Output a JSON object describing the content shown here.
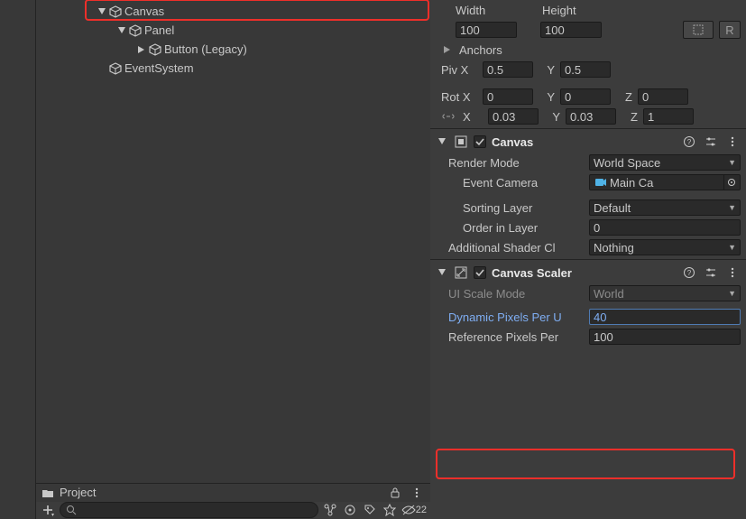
{
  "hierarchy": {
    "items": [
      {
        "label": "Canvas"
      },
      {
        "label": "Panel"
      },
      {
        "label": "Button (Legacy)"
      },
      {
        "label": "EventSystem"
      }
    ]
  },
  "project": {
    "title": "Project",
    "hidden_count": "22"
  },
  "rect": {
    "width_label": "Width",
    "height_label": "Height",
    "width": "100",
    "height": "100",
    "anchors_label": "Anchors",
    "pivot_x_label": "Piv X",
    "pivot_x": "0.5",
    "pivot_y_label": "Y",
    "pivot_y": "0.5",
    "rot_x_label": "Rot X",
    "rot_x": "0",
    "rot_y_label": "Y",
    "rot_y": "0",
    "rot_z_label": "Z",
    "rot_z": "0",
    "scale_x_label": "X",
    "scale_x": "0.03",
    "scale_y_label": "Y",
    "scale_y": "0.03",
    "scale_z_label": "Z",
    "scale_z": "1"
  },
  "canvas_comp": {
    "title": "Canvas",
    "render_mode_label": "Render Mode",
    "render_mode_value": "World Space",
    "event_camera_label": "Event Camera",
    "event_camera_value": "Main Ca",
    "sorting_layer_label": "Sorting Layer",
    "sorting_layer_value": "Default",
    "order_label": "Order in Layer",
    "order_value": "0",
    "shader_label": "Additional Shader Cl",
    "shader_value": "Nothing"
  },
  "scaler_comp": {
    "title": "Canvas Scaler",
    "scale_mode_label": "UI Scale Mode",
    "scale_mode_value": "World",
    "dppu_label": "Dynamic Pixels Per U",
    "dppu_value": "40",
    "rppu_label": "Reference Pixels Per",
    "rppu_value": "100"
  },
  "icons": {
    "r_label": "R"
  }
}
